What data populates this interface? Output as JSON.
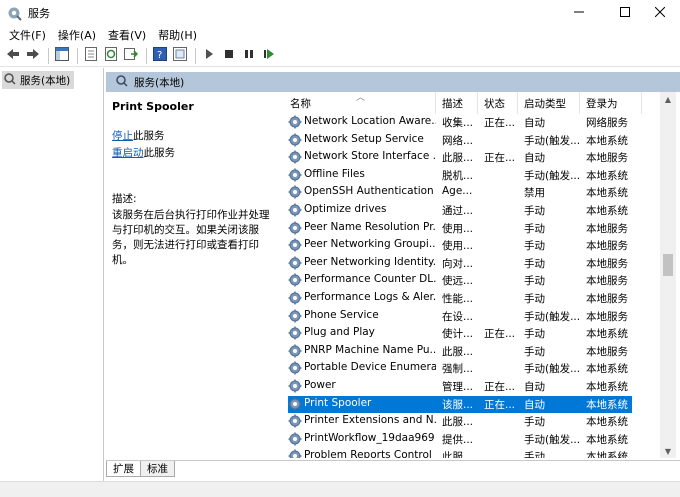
{
  "window": {
    "title": "服务"
  },
  "menu": [
    "文件(F)",
    "操作(A)",
    "查看(V)",
    "帮助(H)"
  ],
  "tree": {
    "item": "服务(本地)"
  },
  "panel_header": "服务(本地)",
  "details": {
    "service_name": "Print Spooler",
    "stop_link": "停止",
    "stop_suffix": "此服务",
    "restart_link": "重启动",
    "restart_suffix": "此服务",
    "desc_label": "描述:",
    "desc_text": "该服务在后台执行打印作业并处理与打印机的交互。如果关闭该服务，则无法进行打印或查看打印机。"
  },
  "columns": {
    "name": "名称",
    "desc": "描述",
    "status": "状态",
    "startup": "启动类型",
    "logon": "登录为"
  },
  "rows": [
    {
      "name": "Network Location Aware...",
      "desc": "收集...",
      "status": "正在...",
      "startup": "自动",
      "logon": "网络服务"
    },
    {
      "name": "Network Setup Service",
      "desc": "网络...",
      "status": "",
      "startup": "手动(触发...",
      "logon": "本地系统"
    },
    {
      "name": "Network Store Interface ...",
      "desc": "此服...",
      "status": "正在...",
      "startup": "自动",
      "logon": "本地服务"
    },
    {
      "name": "Offline Files",
      "desc": "脱机...",
      "status": "",
      "startup": "手动(触发...",
      "logon": "本地系统"
    },
    {
      "name": "OpenSSH Authentication ...",
      "desc": "Age...",
      "status": "",
      "startup": "禁用",
      "logon": "本地系统"
    },
    {
      "name": "Optimize drives",
      "desc": "通过...",
      "status": "",
      "startup": "手动",
      "logon": "本地系统"
    },
    {
      "name": "Peer Name Resolution Pr...",
      "desc": "使用...",
      "status": "",
      "startup": "手动",
      "logon": "本地服务"
    },
    {
      "name": "Peer Networking Groupi...",
      "desc": "使用...",
      "status": "",
      "startup": "手动",
      "logon": "本地服务"
    },
    {
      "name": "Peer Networking Identity...",
      "desc": "向对...",
      "status": "",
      "startup": "手动",
      "logon": "本地服务"
    },
    {
      "name": "Performance Counter DL...",
      "desc": "使远...",
      "status": "",
      "startup": "手动",
      "logon": "本地服务"
    },
    {
      "name": "Performance Logs & Aler...",
      "desc": "性能...",
      "status": "",
      "startup": "手动",
      "logon": "本地服务"
    },
    {
      "name": "Phone Service",
      "desc": "在设...",
      "status": "",
      "startup": "手动(触发...",
      "logon": "本地服务"
    },
    {
      "name": "Plug and Play",
      "desc": "使计...",
      "status": "正在...",
      "startup": "手动",
      "logon": "本地系统"
    },
    {
      "name": "PNRP Machine Name Pu...",
      "desc": "此服...",
      "status": "",
      "startup": "手动",
      "logon": "本地服务"
    },
    {
      "name": "Portable Device Enumera...",
      "desc": "强制...",
      "status": "",
      "startup": "手动(触发...",
      "logon": "本地系统"
    },
    {
      "name": "Power",
      "desc": "管理...",
      "status": "正在...",
      "startup": "自动",
      "logon": "本地系统"
    },
    {
      "name": "Print Spooler",
      "desc": "该服...",
      "status": "正在...",
      "startup": "自动",
      "logon": "本地系统",
      "selected": true
    },
    {
      "name": "Printer Extensions and N...",
      "desc": "此服...",
      "status": "",
      "startup": "手动",
      "logon": "本地系统"
    },
    {
      "name": "PrintWorkflow_19daa969",
      "desc": "提供...",
      "status": "",
      "startup": "手动(触发...",
      "logon": "本地系统"
    },
    {
      "name": "Problem Reports Control ...",
      "desc": "此服...",
      "status": "",
      "startup": "手动",
      "logon": "本地系统"
    }
  ],
  "tabs": [
    "扩展",
    "标准"
  ],
  "colors": {
    "selection": "#0078d7",
    "header_band": "#b4c6da",
    "link": "#0b5fb9"
  },
  "icons": [
    "services-app-icon",
    "minimize-icon",
    "maximize-icon",
    "close-icon",
    "back-icon",
    "forward-icon",
    "console-tree-icon",
    "properties-icon",
    "refresh-icon",
    "export-icon",
    "help-icon",
    "view-icon",
    "start-icon",
    "stop-icon",
    "pause-icon",
    "restart-icon",
    "gear-icon"
  ]
}
